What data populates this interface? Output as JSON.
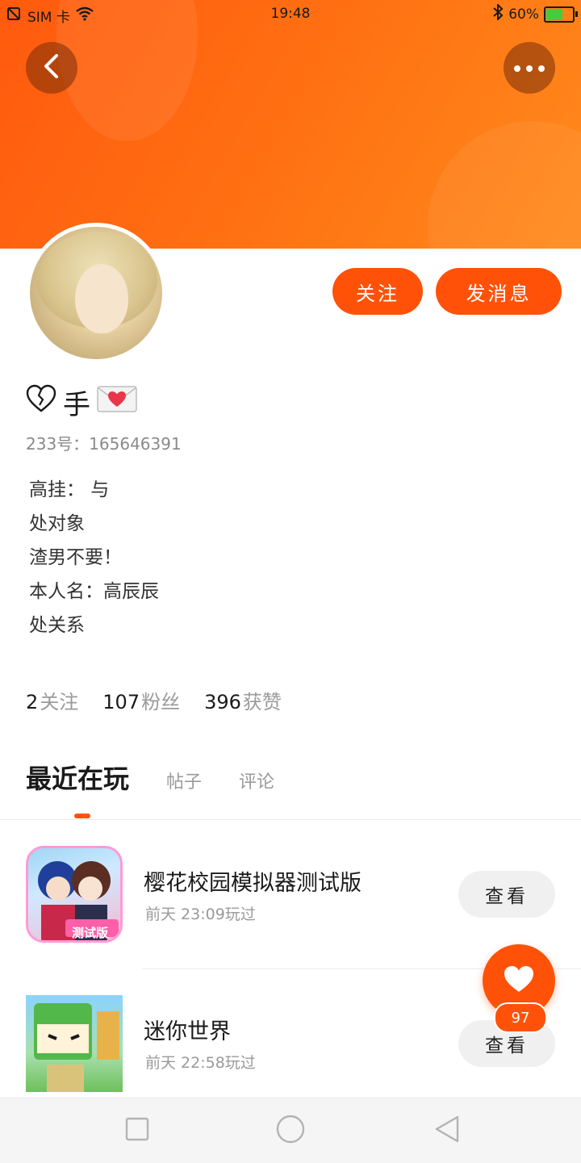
{
  "status_bar": {
    "carrier": "SIM 卡",
    "time": "19:48",
    "battery": "60%",
    "battery_level": 0.6
  },
  "header": {
    "back_icon": "chevron-left-icon",
    "more_icon": "more-dots-icon",
    "gradient_colors": [
      "#ff5a0e",
      "#ff8a1c"
    ]
  },
  "actions": {
    "follow_label": "关注",
    "message_label": "发消息",
    "accent": "#ff5208"
  },
  "profile": {
    "name": "手",
    "id_text": "233号：165646391",
    "bio": [
      "高挂：  与",
      "处对象",
      "渣男不要！",
      "本人名：高辰辰",
      "处关系"
    ]
  },
  "stats": [
    {
      "num": "2",
      "label": "关注"
    },
    {
      "num": "107",
      "label": "粉丝"
    },
    {
      "num": "396",
      "label": "获赞"
    }
  ],
  "tabs": {
    "active": "最近在玩",
    "items": [
      "帖子",
      "评论"
    ]
  },
  "games": [
    {
      "title": "樱花校园模拟器测试版",
      "time": "前天 23:09玩过",
      "button": "查看",
      "badge": "测试版"
    },
    {
      "title": "迷你世界",
      "time": "前天 22:58玩过",
      "button": "查看"
    }
  ],
  "fab": {
    "icon": "heart-icon",
    "count": "97"
  },
  "nav": [
    "square-icon",
    "circle-icon",
    "triangle-back-icon"
  ]
}
